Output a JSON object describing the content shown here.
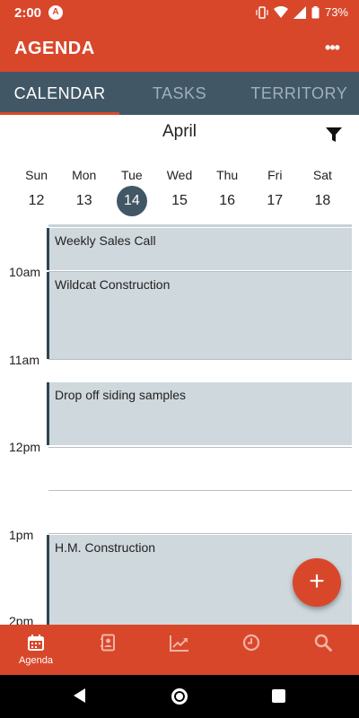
{
  "status_bar": {
    "time": "2:00",
    "app_indicator": "A",
    "battery": "73%"
  },
  "app_bar": {
    "title": "AGENDA",
    "menu_icon": "more-horizontal-icon"
  },
  "tabs": [
    {
      "label": "CALENDAR",
      "active": true
    },
    {
      "label": "TASKS",
      "active": false
    },
    {
      "label": "TERRITORY",
      "active": false
    }
  ],
  "calendar": {
    "month": "April",
    "filter_icon": "filter-icon",
    "days": [
      {
        "name": "Sun",
        "date": "12"
      },
      {
        "name": "Mon",
        "date": "13"
      },
      {
        "name": "Tue",
        "date": "14",
        "selected": true
      },
      {
        "name": "Wed",
        "date": "15"
      },
      {
        "name": "Thu",
        "date": "16"
      },
      {
        "name": "Fri",
        "date": "17"
      },
      {
        "name": "Sat",
        "date": "18"
      }
    ]
  },
  "timeline": {
    "hours": [
      "10am",
      "11am",
      "12pm",
      "1pm",
      "2pm"
    ],
    "events": [
      {
        "title": "Weekly Sales Call"
      },
      {
        "title": "Wildcat Construction"
      },
      {
        "title": "Drop off siding samples"
      },
      {
        "title": "H.M. Construction"
      }
    ]
  },
  "fab": {
    "label": "+"
  },
  "bottom_nav": [
    {
      "icon": "calendar-icon",
      "label": "Agenda",
      "active": true
    },
    {
      "icon": "contacts-book-icon",
      "label": "",
      "active": false
    },
    {
      "icon": "trending-chart-icon",
      "label": "",
      "active": false
    },
    {
      "icon": "clock-icon",
      "label": "",
      "active": false
    },
    {
      "icon": "search-icon",
      "label": "",
      "active": false
    }
  ],
  "colors": {
    "brand": "#d9472b",
    "tab_bar": "#425766",
    "event_bg": "#cfd8dd",
    "event_border": "#2f4450"
  }
}
